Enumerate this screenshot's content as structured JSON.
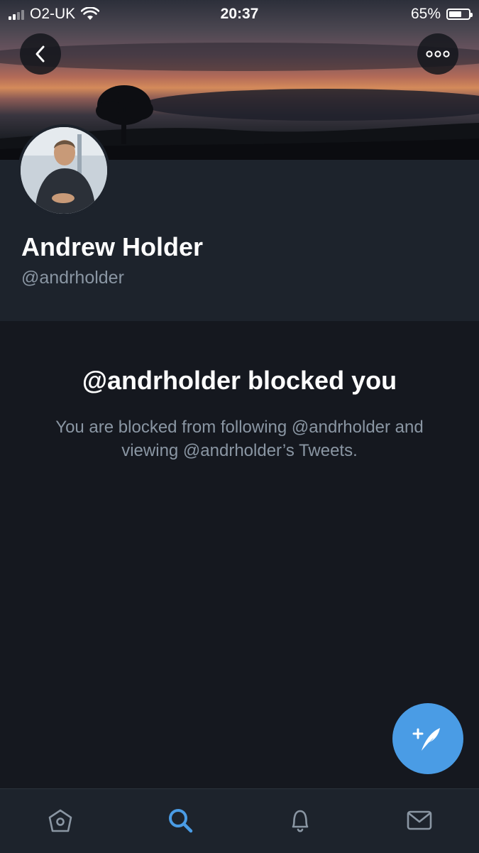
{
  "status_bar": {
    "carrier": "O2-UK",
    "time": "20:37",
    "battery_percent": "65%",
    "battery_level": 0.65,
    "signal_bars": 2,
    "wifi_icon": "wifi-icon"
  },
  "header": {
    "back_icon": "chevron-left-icon",
    "more_icon": "more-horizontal-icon"
  },
  "profile": {
    "display_name": "Andrew Holder",
    "handle": "@andrholder"
  },
  "blocked": {
    "title": "@andrholder blocked you",
    "message": "You are blocked from following @andrholder and viewing @andrholder’s Tweets."
  },
  "compose": {
    "icon": "compose-tweet-icon"
  },
  "tab_bar": {
    "items": [
      {
        "name": "home",
        "icon": "home-icon",
        "active": false
      },
      {
        "name": "search",
        "icon": "search-icon",
        "active": true
      },
      {
        "name": "notifications",
        "icon": "bell-icon",
        "active": false
      },
      {
        "name": "messages",
        "icon": "mail-icon",
        "active": false
      }
    ]
  },
  "colors": {
    "background": "#15181f",
    "profile_panel": "#1d232c",
    "accent": "#4a9ce5",
    "secondary_text": "#8a96a3",
    "icon_inactive": "#8a96a3"
  }
}
